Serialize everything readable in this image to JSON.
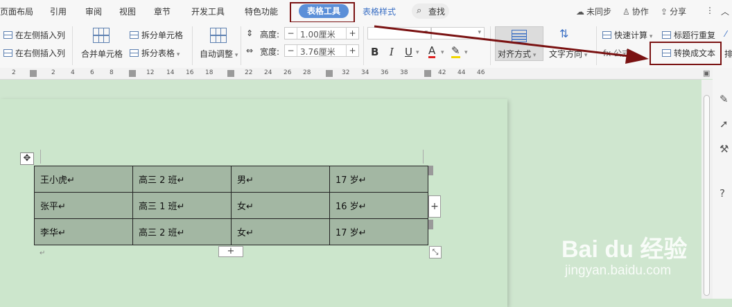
{
  "menubar": {
    "tabs": [
      "页面布局",
      "引用",
      "审阅",
      "视图",
      "章节",
      "开发工具",
      "特色功能"
    ],
    "active_tab": "表格工具",
    "style_tab": "表格样式",
    "find": "查找",
    "sync": "未同步",
    "collab": "协作",
    "share": "分享",
    "more": "⋮",
    "collapse": "︿"
  },
  "ribbon": {
    "insert_left_col": "在左侧插入列",
    "insert_right_col": "在右侧插入列",
    "merge_cells": "合并单元格",
    "split_cells": "拆分单元格",
    "split_table": "拆分表格",
    "auto_fit": "自动调整",
    "height_label": "高度:",
    "height_value": "1.00厘米",
    "width_label": "宽度:",
    "width_value": "3.76厘米",
    "align": "对齐方式",
    "text_direction": "文字方向",
    "quick_calc": "快速计算",
    "header_repeat": "标题行重复",
    "convert_to_text": "转换成文本",
    "formula": "fx 公式",
    "sort_short": "排",
    "bold": "B",
    "italic": "I",
    "underline": "U",
    "font_color": "A",
    "highlight": "✎"
  },
  "ruler": {
    "ticks": [
      "2",
      "2",
      "4",
      "6",
      "8",
      "12",
      "14",
      "16",
      "18",
      "22",
      "24",
      "26",
      "28",
      "32",
      "34",
      "36",
      "38",
      "42",
      "44",
      "46"
    ]
  },
  "table": {
    "rows": [
      [
        "王小虎↵",
        "高三 2 班↵",
        "男↵",
        "17 岁↵"
      ],
      [
        "张平↵",
        "高三 1 班↵",
        "女↵",
        "16 岁↵"
      ],
      [
        "李华↵",
        "高三 2 班↵",
        "女↵",
        "17 岁↵"
      ]
    ]
  },
  "doc": {
    "paragraph_mark": "↵"
  },
  "watermark": {
    "main": "Bai du 经验",
    "url": "jingyan.baidu.com"
  },
  "colors": {
    "annotation": "#7a1212",
    "active_tab": "#5b8fd8",
    "page_bg": "#cce6cc",
    "table_fill": "#a3b7a3"
  }
}
